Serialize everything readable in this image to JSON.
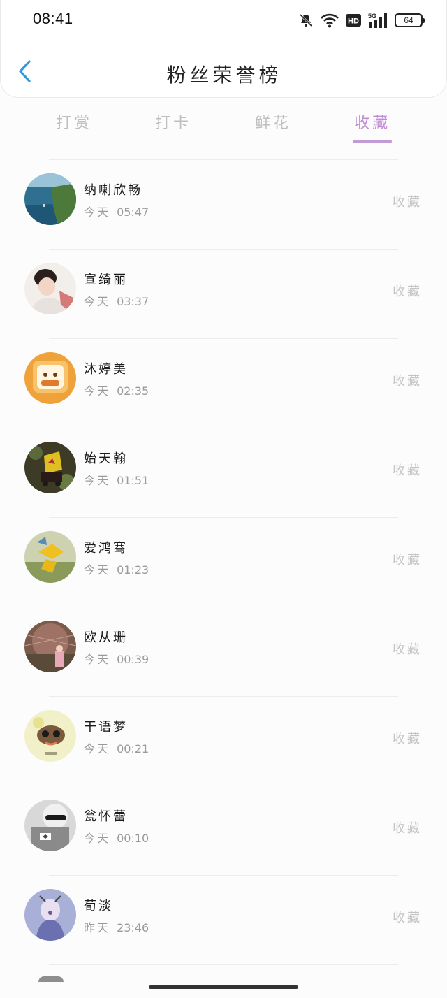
{
  "status_bar": {
    "time": "08:41",
    "icons": [
      "bell-off-icon",
      "wifi-icon",
      "hd-icon",
      "signal-5g-icon"
    ],
    "battery": "64"
  },
  "nav": {
    "back_icon": "chevron-left-icon",
    "title": "粉丝荣誉榜"
  },
  "tabs": [
    {
      "label": "打赏",
      "active": false
    },
    {
      "label": "打卡",
      "active": false
    },
    {
      "label": "鲜花",
      "active": false
    },
    {
      "label": "收藏",
      "active": true
    }
  ],
  "colors": {
    "accent": "#c39ad8",
    "active_tab_text": "#c08cd4",
    "back_arrow": "#2e9bdc"
  },
  "list": [
    {
      "name": "纳喇欣畅",
      "day": "今天",
      "time": "05:47",
      "action": "收藏"
    },
    {
      "name": "宣绮丽",
      "day": "今天",
      "time": "03:37",
      "action": "收藏"
    },
    {
      "name": "沐婷美",
      "day": "今天",
      "time": "02:35",
      "action": "收藏"
    },
    {
      "name": "始天翰",
      "day": "今天",
      "time": "01:51",
      "action": "收藏"
    },
    {
      "name": "爱鸿骞",
      "day": "今天",
      "time": "01:23",
      "action": "收藏"
    },
    {
      "name": "欧从珊",
      "day": "今天",
      "time": "00:39",
      "action": "收藏"
    },
    {
      "name": "干语梦",
      "day": "今天",
      "time": "00:21",
      "action": "收藏"
    },
    {
      "name": "瓮怀蕾",
      "day": "今天",
      "time": "00:10",
      "action": "收藏"
    },
    {
      "name": "荀淡",
      "day": "昨天",
      "time": "23:46",
      "action": "收藏"
    }
  ]
}
